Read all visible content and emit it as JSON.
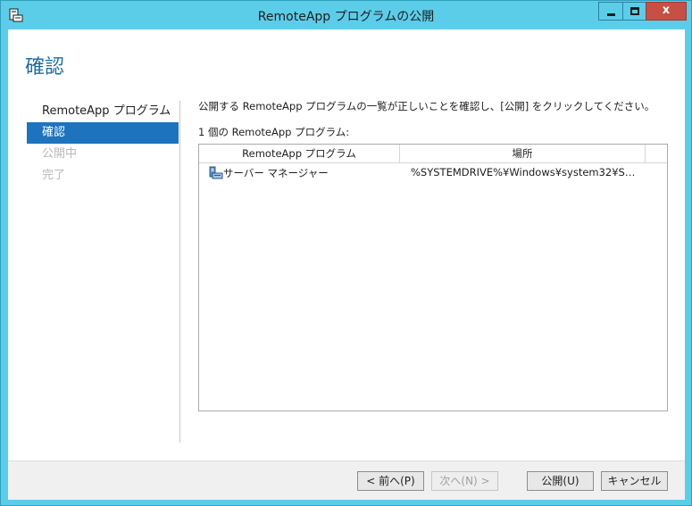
{
  "window": {
    "title": "RemoteApp プログラムの公開",
    "close_label": "x"
  },
  "page": {
    "heading": "確認"
  },
  "nav": {
    "items": [
      {
        "label": "RemoteApp プログラム",
        "state": "normal"
      },
      {
        "label": "確認",
        "state": "selected"
      },
      {
        "label": "公開中",
        "state": "disabled"
      },
      {
        "label": "完了",
        "state": "disabled"
      }
    ]
  },
  "main": {
    "description": "公開する RemoteApp プログラムの一覧が正しいことを確認し、[公開] をクリックしてください。",
    "count_label": "1 個の RemoteApp プログラム:",
    "table": {
      "columns": [
        "RemoteApp プログラム",
        "場所"
      ],
      "rows": [
        {
          "name": "サーバー マネージャー",
          "location": "%SYSTEMDRIVE%¥Windows¥system32¥S…",
          "icon": "server-manager-icon"
        }
      ]
    }
  },
  "footer": {
    "prev_label": "< 前へ(P)",
    "next_label": "次へ(N) >",
    "publish_label": "公開(U)",
    "cancel_label": "キャンセル"
  },
  "colors": {
    "frame": "#5ccde9",
    "accent": "#1e73be",
    "heading": "#1f6ea0",
    "close": "#c74f44"
  }
}
